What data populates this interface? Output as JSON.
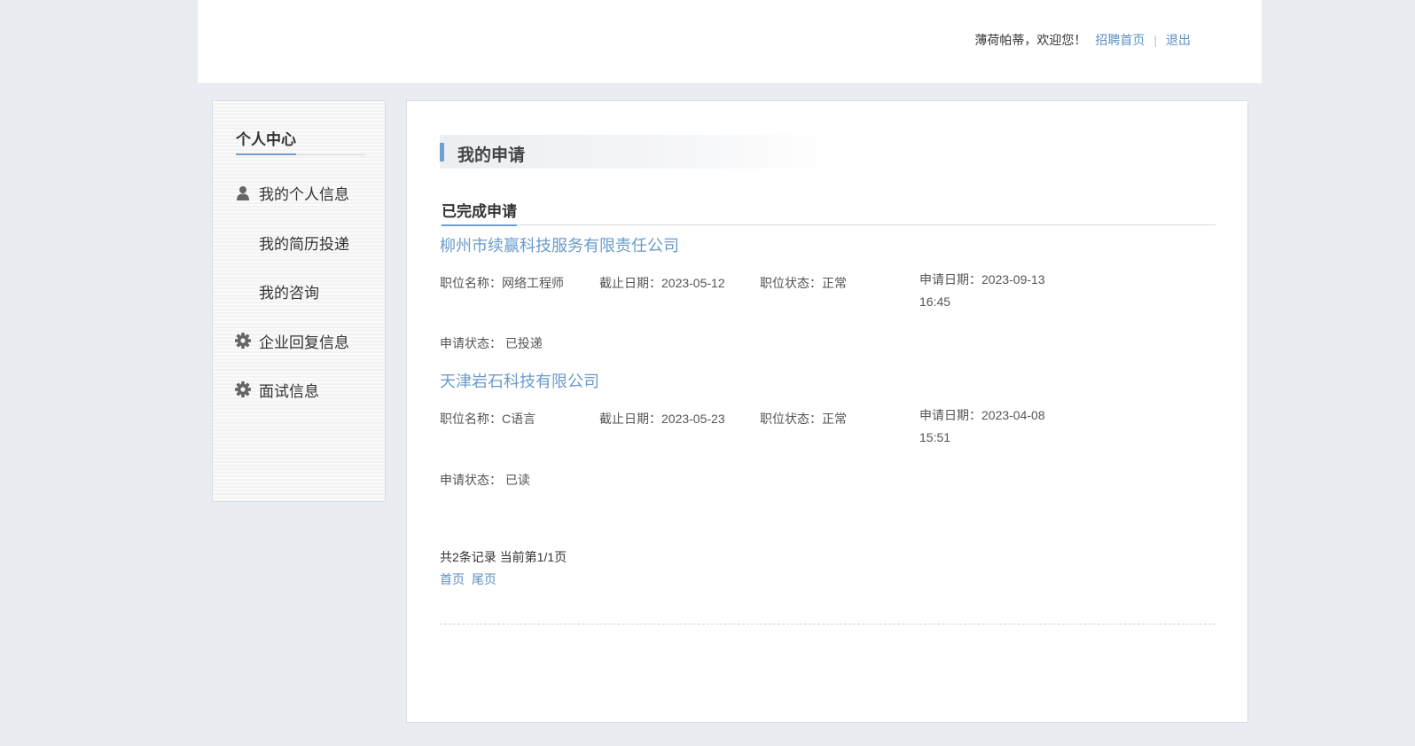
{
  "header": {
    "welcome": "薄荷帕蒂，欢迎您！",
    "home_link": "招聘首页",
    "separator": "|",
    "logout": "退出"
  },
  "sidebar": {
    "title": "个人中心",
    "items": [
      {
        "label": "我的个人信息",
        "icon": "user-icon"
      },
      {
        "label": "我的简历投递",
        "icon": ""
      },
      {
        "label": "我的咨询",
        "icon": ""
      },
      {
        "label": "企业回复信息",
        "icon": "gear-icon"
      },
      {
        "label": "面试信息",
        "icon": "gear-icon"
      }
    ]
  },
  "main": {
    "section_title": "我的申请",
    "tab": "已完成申请",
    "applications": [
      {
        "company": "柳州市续赢科技服务有限责任公司",
        "position": "职位名称：网络工程师",
        "deadline": "截止日期：2023-05-12",
        "status": "职位状态：正常",
        "apply_date": "申请日期：2023-09-13 16:45",
        "apply_status": "申请状态： 已投递"
      },
      {
        "company": "天津岩石科技有限公司",
        "position": "职位名称：C语言",
        "deadline": "截止日期：2023-05-23",
        "status": "职位状态：正常",
        "apply_date": "申请日期：2023-04-08 15:51",
        "apply_status": "申请状态： 已读"
      }
    ],
    "pager": {
      "info": "共2条记录 当前第1/1页",
      "first": "首页",
      "last": "尾页"
    }
  },
  "colors": {
    "accent": "#6f9fcf",
    "link": "#5b8fc4",
    "background": "#e9edf1"
  }
}
